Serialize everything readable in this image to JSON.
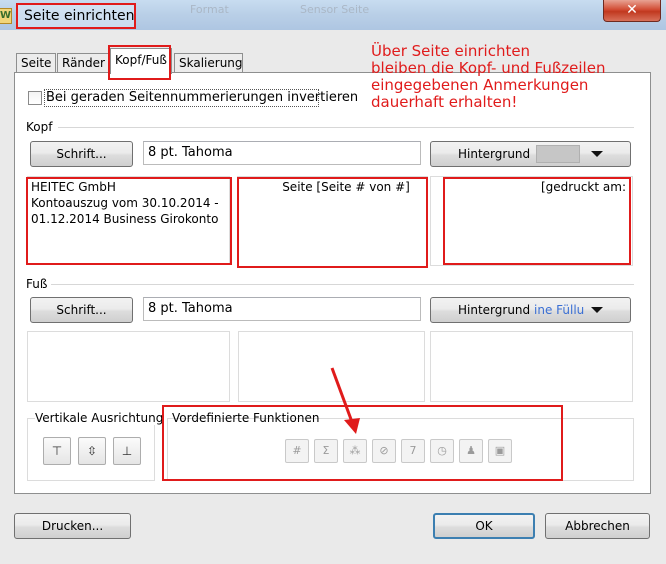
{
  "window": {
    "title": "Seite einrichten",
    "close_symbol": "✕",
    "background_app_items": [
      "Format",
      "Sensor Seite"
    ]
  },
  "tabs": [
    {
      "label": "Seite",
      "active": false
    },
    {
      "label": "Ränder",
      "active": false
    },
    {
      "label": "Kopf/Fuß",
      "active": true
    },
    {
      "label": "Skalierung",
      "active": false
    }
  ],
  "annotation_text": "Über Seite einrichten\nbleiben die Kopf- und Fußzeilen\neingegebenen Anmerkungen\ndauerhaft erhalten!",
  "invert_checkbox": {
    "label": "Bei geraden Seitennummerierungen invertieren",
    "checked": false
  },
  "kopf": {
    "group_label": "Kopf",
    "font_button": "Schrift...",
    "font_value": "8 pt. Tahoma",
    "background_button": "Hintergrund",
    "background_swatch_color": "#c6c6c6",
    "left_text": "HEITEC GmbH\nKontoauszug vom 30.10.2014 -\n01.12.2014 Business Girokonto",
    "center_text": "Seite [Seite # von #]",
    "right_text": "[gedruckt am:"
  },
  "fuss": {
    "group_label": "Fuß",
    "font_button": "Schrift...",
    "font_value": "8 pt. Tahoma",
    "background_button": "Hintergrund",
    "background_fill": "ine Füllu",
    "left_text": "",
    "center_text": "",
    "right_text": ""
  },
  "vertical_alignment": {
    "label": "Vertikale Ausrichtung",
    "buttons": [
      "⊤",
      "⇳",
      "⊥"
    ]
  },
  "predefined_functions": {
    "label": "Vordefinierte Funktionen",
    "icons": [
      "page-number-icon",
      "page-count-icon",
      "date-icon",
      "time-icon",
      "calendar-icon",
      "clock-icon",
      "user-icon",
      "computer-icon"
    ],
    "glyphs": [
      "#",
      "Σ",
      "⁂",
      "⊘",
      "7",
      "◷",
      "♟",
      "▣"
    ]
  },
  "footer_buttons": {
    "print": "Drucken...",
    "ok": "OK",
    "cancel": "Abbrechen"
  },
  "colors": {
    "highlight_red": "#e01b1b",
    "link_blue": "#3a6fd4",
    "ok_focus": "#3c7fb1"
  }
}
